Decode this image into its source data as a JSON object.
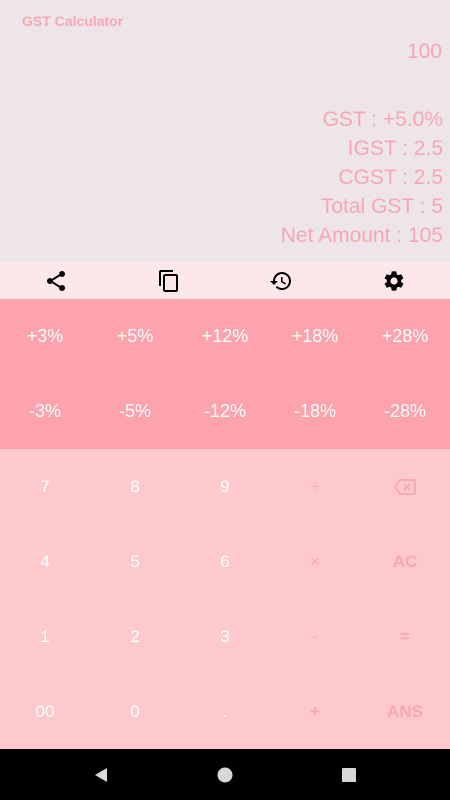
{
  "app": {
    "title": "GST Calculator"
  },
  "display": {
    "input": "100",
    "results": [
      "GST : +5.0%",
      "IGST : 2.5",
      "CGST : 2.5",
      "Total GST : 5",
      "Net Amount : 105"
    ]
  },
  "toolbar": {
    "icons": [
      "share-icon",
      "copy-icon",
      "history-icon",
      "settings-icon"
    ]
  },
  "gst_keys": {
    "add": [
      "+3%",
      "+5%",
      "+12%",
      "+18%",
      "+28%"
    ],
    "subtract": [
      "-3%",
      "-5%",
      "-12%",
      "-18%",
      "-28%"
    ]
  },
  "keypad": {
    "rows": [
      [
        "7",
        "8",
        "9",
        "÷",
        "⌫"
      ],
      [
        "4",
        "5",
        "6",
        "×",
        "AC"
      ],
      [
        "1",
        "2",
        "3",
        "-",
        "="
      ],
      [
        "00",
        "0",
        ".",
        "+",
        "ANS"
      ]
    ]
  },
  "colors": {
    "accent": "#f7a7b3",
    "gst_pad": "#fda3ae",
    "num_pad": "#fec9cc",
    "toolbar": "#fde7e9",
    "display_bg": "#ede5e8"
  },
  "nav": {
    "icons": [
      "back-icon",
      "home-icon",
      "recents-icon"
    ]
  }
}
